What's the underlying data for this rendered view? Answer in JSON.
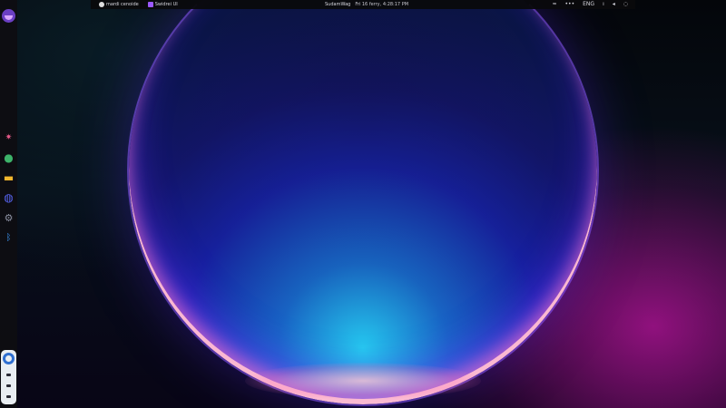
{
  "topbar": {
    "left_items": [
      {
        "label": "mardi cenoide",
        "icon": "circle-app-icon"
      },
      {
        "label": "Swidrei UI",
        "icon": "purple-square-app-icon"
      }
    ],
    "center": {
      "label": "SudamWag",
      "clock": "Fri 16 ferry, 4:28:17 PM"
    },
    "right_items": [
      {
        "icon": "wifi-icon",
        "glyph": "≈"
      },
      {
        "icon": "more-icon",
        "glyph": "•••"
      },
      {
        "icon": "keyboard-layout",
        "label": "ENG"
      },
      {
        "icon": "microphone-icon",
        "glyph": "ı"
      },
      {
        "icon": "volume-icon",
        "glyph": "◂"
      },
      {
        "icon": "notification-icon",
        "glyph": "◌"
      }
    ]
  },
  "dock": {
    "launcher_icon": "launcher-icon",
    "apps": [
      {
        "name": "dock-app-colorful",
        "glyph": "✷",
        "color": "#e85a8a"
      },
      {
        "name": "dock-app-green-globe",
        "glyph": "●",
        "color": "#3db36a"
      },
      {
        "name": "dock-app-folder",
        "glyph": "▬",
        "color": "#f2b62d"
      },
      {
        "name": "dock-app-discord",
        "glyph": "◍",
        "color": "#5865f2"
      },
      {
        "name": "dock-app-settings",
        "glyph": "⚙",
        "color": "#8a8fa0"
      },
      {
        "name": "dock-app-bluetooth",
        "glyph": "ᛒ",
        "color": "#3a8fe8"
      }
    ]
  },
  "wallpaper": {
    "colors": {
      "orb_core": "#1a1490",
      "orb_glow": "#28dcff",
      "accent_magenta": "#be14a0",
      "rim": "#ffbed2"
    }
  }
}
